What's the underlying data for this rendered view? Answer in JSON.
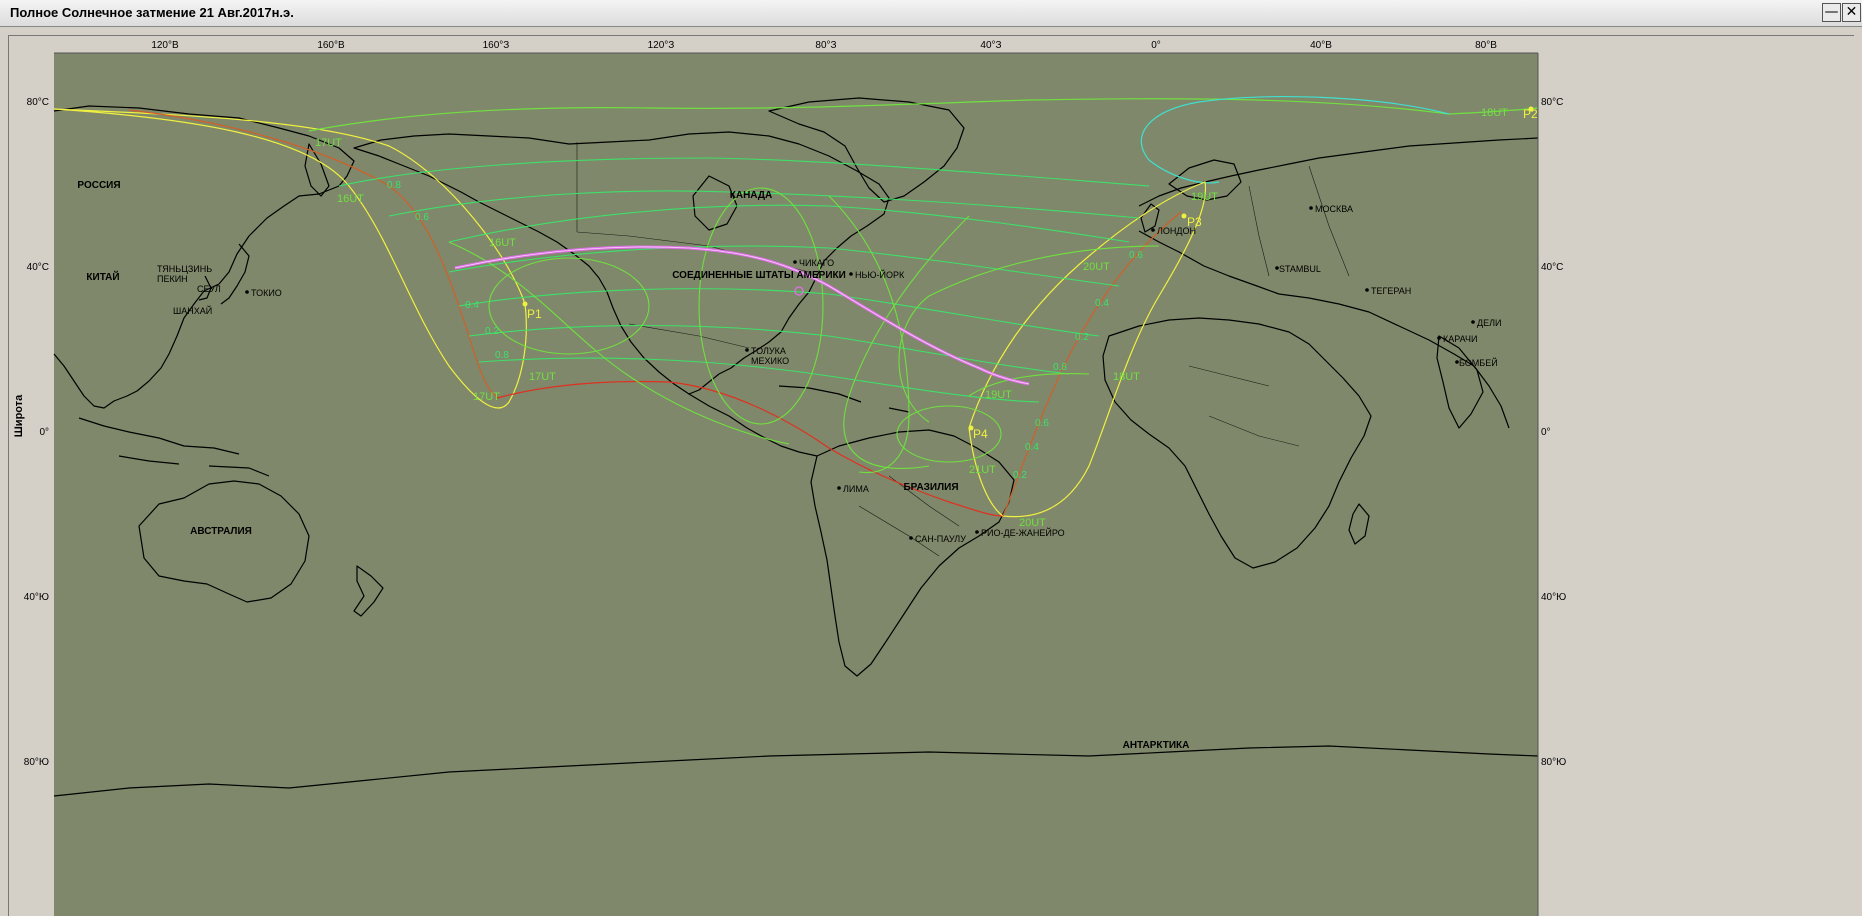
{
  "window": {
    "title": "Полное Солнечное затмение 21 Авг.2017н.э.",
    "minimize_glyph": "—",
    "close_glyph": "✕"
  },
  "map": {
    "background": "#7f886a",
    "axis_label_y": "Широта",
    "longitude_labels": [
      "120°В",
      "160°В",
      "160°З",
      "120°З",
      "80°З",
      "40°З",
      "0°",
      "40°В",
      "80°В"
    ],
    "latitude_labels_left": [
      "80°С",
      "40°С",
      "0°",
      "40°Ю",
      "80°Ю"
    ],
    "latitude_labels_right": [
      "80°С",
      "40°С",
      "0°",
      "40°Ю",
      "80°Ю"
    ]
  },
  "regions": {
    "russia": "РОССИЯ",
    "china": "КИТАЙ",
    "canada": "КАНАДА",
    "usa": "СОЕДИНЕННЫЕ ШТАТЫ АМЕРИКИ",
    "brazil": "БРАЗИЛИЯ",
    "australia": "АВСТРАЛИЯ",
    "antarctica": "АНТАРКТИКА"
  },
  "cities": {
    "moscow": "МОСКВА",
    "istanbul": "STAMBUL",
    "tehran": "ТЕГЕРАН",
    "delhi": "ДЕЛИ",
    "karachi": "КАРАЧИ",
    "bombay": "БОМБЕЙ",
    "london": "ЛОНДОН",
    "tokyo": "ТОКИО",
    "tianjin": "ТЯНЬЦЗИНЬ",
    "beijing": "ПЕКИН",
    "seoul": "СЕУЛ",
    "shanghai": "ШАНХАЙ",
    "chicago": "ЧИКАГО",
    "new_york": "НЬЮ-ЙОРК",
    "toluca": "ТОЛУКА",
    "mexico": "МЕХИКО",
    "lima": "ЛИМА",
    "sao_paulo": "САН-ПАУЛУ",
    "rio": "РИО-ДЕ-ЖАНЕЙРО"
  },
  "eclipse": {
    "points": {
      "p1": "P1",
      "p2": "P2",
      "p3": "P3",
      "p4": "P4"
    },
    "time_labels": {
      "t16_west": "16UT",
      "t17_west": "17UT",
      "t16_pacific": "16UT",
      "t17_pacific": "17UT",
      "t18_mid": "18UT",
      "t20_east": "20UT",
      "t19_atl": "19UT",
      "t21_brazil": "21UT",
      "t20_south": "20UT",
      "t18_arctic": "18UT",
      "t19_europe": "19UT",
      "t15_alaska": "17UT"
    },
    "magnitude_labels": [
      "0.8",
      "0.6",
      "0.4",
      "0.2",
      "0.8",
      "0.6",
      "0.4",
      "0.2",
      "0.8",
      "0.6",
      "0.4",
      "0.2"
    ],
    "colors": {
      "totality_path": "#e070e8",
      "penumbra_limits": "#f0f040",
      "magnitude_lines": "#3ee06a",
      "time_lines": "#70e040",
      "rise_set": "#d0602a",
      "northern_limit": "#40e0d0",
      "coastline": "#000000"
    }
  }
}
